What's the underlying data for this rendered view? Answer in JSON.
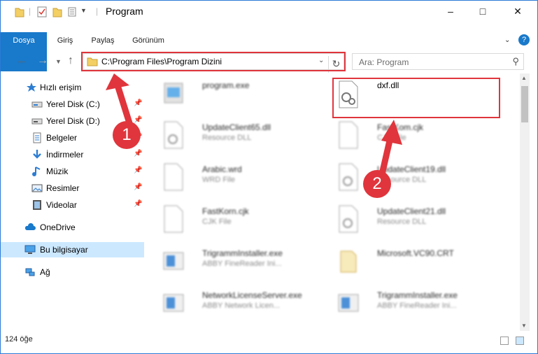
{
  "window": {
    "title": "Program"
  },
  "ribbon": {
    "tabs": [
      "Dosya",
      "Giriş",
      "Paylaş",
      "Görünüm"
    ],
    "help": "?"
  },
  "address": {
    "path": "C:\\Program Files\\Program Dizini"
  },
  "search": {
    "placeholder": "Ara: Program"
  },
  "sidebar": {
    "items": [
      {
        "label": "Hızlı erişim",
        "icon": "star-icon"
      },
      {
        "label": "Yerel Disk (C:)",
        "icon": "drive-icon",
        "pinned": true
      },
      {
        "label": "Yerel Disk (D:)",
        "icon": "drive-icon",
        "pinned": true
      },
      {
        "label": "Belgeler",
        "icon": "document-icon",
        "pinned": true
      },
      {
        "label": "İndirmeler",
        "icon": "download-icon",
        "pinned": true
      },
      {
        "label": "Müzik",
        "icon": "music-icon",
        "pinned": true
      },
      {
        "label": "Resimler",
        "icon": "pictures-icon",
        "pinned": true
      },
      {
        "label": "Videolar",
        "icon": "video-icon",
        "pinned": true
      },
      {
        "label": "OneDrive",
        "icon": "cloud-icon"
      },
      {
        "label": "Bu bilgisayar",
        "icon": "computer-icon",
        "selected": true
      },
      {
        "label": "Ağ",
        "icon": "network-icon"
      }
    ]
  },
  "files": [
    {
      "name": "program.exe",
      "sub": "",
      "icon": "exe-icon"
    },
    {
      "name": "dxf.dll",
      "sub": "",
      "icon": "dll-icon"
    },
    {
      "name": "UpdateClient65.dll",
      "sub": "Resource DLL",
      "icon": "dll-icon"
    },
    {
      "name": "FastKom.cjk",
      "sub": "CJK File",
      "icon": "file-icon"
    },
    {
      "name": "Arabic.wrd",
      "sub": "WRD File",
      "icon": "file-icon"
    },
    {
      "name": "UpdateClient19.dll",
      "sub": "Resource DLL",
      "icon": "dll-icon"
    },
    {
      "name": "FastKorn.cjk",
      "sub": "CJK File",
      "icon": "file-icon"
    },
    {
      "name": "UpdateClient21.dll",
      "sub": "Resource DLL",
      "icon": "dll-icon"
    },
    {
      "name": "TrigrammInstaller.exe",
      "sub": "ABBY FineReader Ini...",
      "icon": "app-icon"
    },
    {
      "name": "Microsoft.VC90.CRT",
      "sub": "",
      "icon": "folder-icon"
    },
    {
      "name": "NetworkLicenseServer.exe",
      "sub": "ABBY Network Licen...",
      "icon": "app-icon"
    },
    {
      "name": "TrigrammInstaller.exe",
      "sub": "ABBY FineReader Ini...",
      "icon": "app-icon"
    }
  ],
  "status": {
    "count": "124 öğe"
  },
  "callouts": [
    "1",
    "2"
  ],
  "colors": {
    "accent": "#1979ca",
    "highlight": "#e0353c",
    "selected": "#cce8ff"
  }
}
